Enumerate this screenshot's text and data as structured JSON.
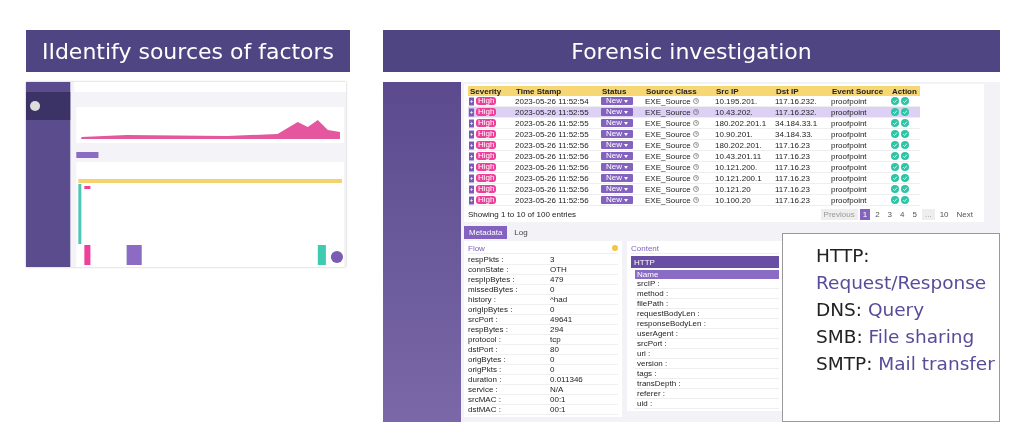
{
  "titles": [
    {
      "text": "IIdentify sources of factors"
    },
    {
      "text": "Forensic investigation"
    }
  ],
  "events": {
    "columns": [
      "Severity",
      "Time Stamp",
      "Status",
      "Source Class",
      "Src IP",
      "Dst IP",
      "Event Source",
      "Action"
    ],
    "rows": [
      {
        "severity": "High",
        "time": "2023-05-26 11:52:54",
        "status": "New",
        "source_class": "EXE_Source",
        "src_ip": "10.195.201.",
        "dst_ip": "117.16.232.",
        "event_source": "proofpoint",
        "selected": false
      },
      {
        "severity": "High",
        "time": "2023-05-26 11:52:55",
        "status": "New",
        "source_class": "EXE_Source",
        "src_ip": "10.43.202.",
        "dst_ip": "117.16.232.",
        "event_source": "proofpoint",
        "selected": true
      },
      {
        "severity": "High",
        "time": "2023-05-26 11:52:55",
        "status": "New",
        "source_class": "EXE_Source",
        "src_ip": "180.202.201.1",
        "dst_ip": "34.184.33.1",
        "event_source": "proofpoint",
        "selected": false
      },
      {
        "severity": "High",
        "time": "2023-05-26 11:52:55",
        "status": "New",
        "source_class": "EXE_Source",
        "src_ip": "10.90.201.",
        "dst_ip": "34.184.33.",
        "event_source": "proofpoint",
        "selected": false
      },
      {
        "severity": "High",
        "time": "2023-05-26 11:52:56",
        "status": "New",
        "source_class": "EXE_Source",
        "src_ip": "180.202.201.",
        "dst_ip": "117.16.23",
        "event_source": "proofpoint",
        "selected": false
      },
      {
        "severity": "High",
        "time": "2023-05-26 11:52:56",
        "status": "New",
        "source_class": "EXE_Source",
        "src_ip": "10.43.201.11",
        "dst_ip": "117.16.23",
        "event_source": "proofpoint",
        "selected": false
      },
      {
        "severity": "High",
        "time": "2023-05-26 11:52:56",
        "status": "New",
        "source_class": "EXE_Source",
        "src_ip": "10.121.200.",
        "dst_ip": "117.16.23",
        "event_source": "proofpoint",
        "selected": false
      },
      {
        "severity": "High",
        "time": "2023-05-26 11:52:56",
        "status": "New",
        "source_class": "EXE_Source",
        "src_ip": "10.121.200.1",
        "dst_ip": "117.16.23",
        "event_source": "proofpoint",
        "selected": false
      },
      {
        "severity": "High",
        "time": "2023-05-26 11:52:56",
        "status": "New",
        "source_class": "EXE_Source",
        "src_ip": "10.121.20",
        "dst_ip": "117.16.23",
        "event_source": "proofpoint",
        "selected": false
      },
      {
        "severity": "High",
        "time": "2023-05-26 11:52:56",
        "status": "New",
        "source_class": "EXE_Source",
        "src_ip": "10.100.20",
        "dst_ip": "117.16.23",
        "event_source": "proofpoint",
        "selected": false
      }
    ],
    "footer": "Showing 1 to 10 of 100 entries",
    "pagination": [
      {
        "label": "Previous",
        "selected": false,
        "disabled": true
      },
      {
        "label": "1",
        "selected": true,
        "disabled": false
      },
      {
        "label": "2",
        "selected": false,
        "disabled": false
      },
      {
        "label": "3",
        "selected": false,
        "disabled": false
      },
      {
        "label": "4",
        "selected": false,
        "disabled": false
      },
      {
        "label": "5",
        "selected": false,
        "disabled": false
      },
      {
        "label": "...",
        "selected": false,
        "disabled": true
      },
      {
        "label": "10",
        "selected": false,
        "disabled": false
      },
      {
        "label": "Next",
        "selected": false,
        "disabled": false
      }
    ]
  },
  "tabs": [
    {
      "label": "Metadata",
      "selected": true
    },
    {
      "label": "Log",
      "selected": false
    }
  ],
  "flow": {
    "title": "Flow",
    "fields": [
      {
        "name": "respPkts :",
        "value": "3"
      },
      {
        "name": "connState :",
        "value": "OTH"
      },
      {
        "name": "respIpBytes :",
        "value": "479"
      },
      {
        "name": "missedBytes :",
        "value": "0"
      },
      {
        "name": "history :",
        "value": "^had"
      },
      {
        "name": "origIpBytes :",
        "value": "0"
      },
      {
        "name": "srcPort :",
        "value": "49641"
      },
      {
        "name": "respBytes :",
        "value": "294"
      },
      {
        "name": "protocol :",
        "value": "tcp"
      },
      {
        "name": "dstPort :",
        "value": "80"
      },
      {
        "name": "origBytes :",
        "value": "0"
      },
      {
        "name": "origPkts :",
        "value": "0"
      },
      {
        "name": "duration :",
        "value": "0.011346"
      },
      {
        "name": "service :",
        "value": "N/A"
      },
      {
        "name": "srcMAC :",
        "value": "00:1"
      },
      {
        "name": "dstMAC :",
        "value": "00:1"
      }
    ]
  },
  "content": {
    "title": "Content",
    "section": "HTTP",
    "column": "Name",
    "fields": [
      "srcIP :",
      "method :",
      "filePath :",
      "requestBodyLen :",
      "responseBodyLen :",
      "userAgent :",
      "srcPort :",
      "uri :",
      "version :",
      "tags :",
      "transDepth :",
      "referer :",
      "uid :"
    ]
  },
  "callout": [
    {
      "protocol": "HTTP:",
      "description": "Request/Response",
      "kind": "stacked"
    },
    {
      "protocol": "DNS:",
      "description": "Query",
      "kind": "inline"
    },
    {
      "protocol": "SMB:",
      "description": "File sharing",
      "kind": "inline"
    },
    {
      "protocol": "SMTP:",
      "description": "Mail transfer",
      "kind": "inline"
    }
  ]
}
